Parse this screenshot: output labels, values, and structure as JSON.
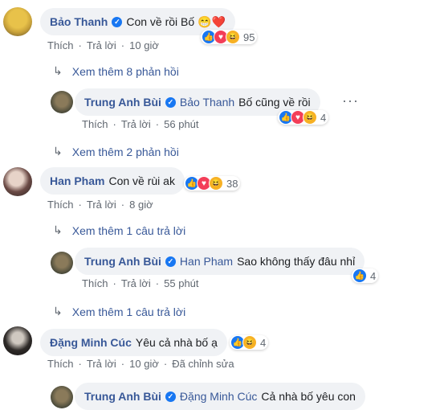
{
  "comments": [
    {
      "author": "Bảo Thanh",
      "text": "Con về rồi Bố 😁❤️",
      "reaction_count": "95",
      "like_label": "Thích",
      "reply_label": "Trả lời",
      "time": "10 giờ",
      "more_replies": "Xem thêm 8 phản hồi"
    },
    {
      "author": "Trung Anh Bùi",
      "mention": "Bảo Thanh",
      "text": "Bố cũng về rồi",
      "reaction_count": "4",
      "like_label": "Thích",
      "reply_label": "Trả lời",
      "time": "56 phút",
      "more_replies": "Xem thêm 2 phản hồi"
    },
    {
      "author": "Han Pham",
      "text": "Con về rùi ak",
      "reaction_count": "38",
      "like_label": "Thích",
      "reply_label": "Trả lời",
      "time": "8 giờ",
      "more_replies": "Xem thêm 1 câu trả lời"
    },
    {
      "author": "Trung Anh Bùi",
      "mention": "Han Pham",
      "text": "Sao không thấy đâu nhỉ",
      "reaction_count": "4",
      "like_label": "Thích",
      "reply_label": "Trả lời",
      "time": "55 phút",
      "more_replies": "Xem thêm 1 câu trả lời"
    },
    {
      "author": "Đặng Minh Cúc",
      "text": "Yêu cả nhà bố ạ",
      "reaction_count": "4",
      "like_label": "Thích",
      "reply_label": "Trả lời",
      "time": "10 giờ",
      "edited": "Đã chỉnh sửa"
    },
    {
      "author": "Trung Anh Bùi",
      "mention": "Đặng Minh Cúc",
      "text": "Cả nhà bố yêu con"
    }
  ],
  "colors": {
    "link": "#385898",
    "bubble": "#f0f2f5",
    "meta": "#606770",
    "like": "#1877f2",
    "love": "#f33e58",
    "haha": "#f7b125"
  }
}
